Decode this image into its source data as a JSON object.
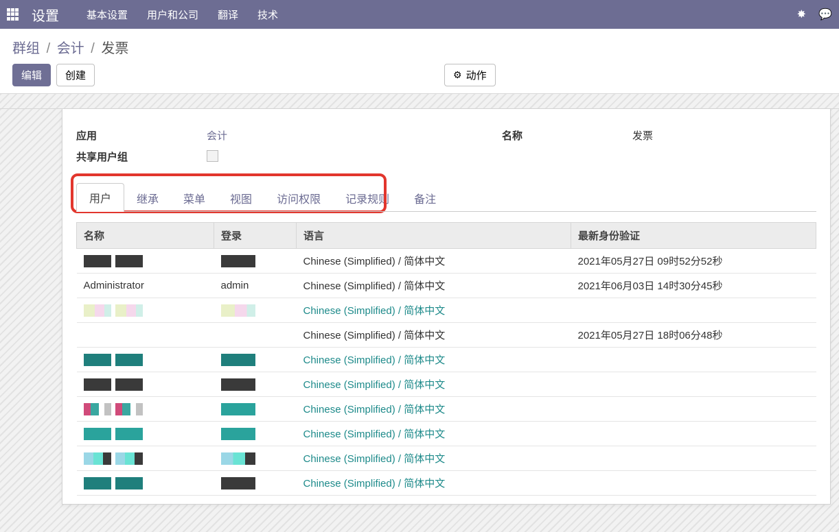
{
  "topnav": {
    "brand": "设置",
    "menu": [
      "基本设置",
      "用户和公司",
      "翻译",
      "技术"
    ]
  },
  "breadcrumb": {
    "root": "群组",
    "mid": "会计",
    "current": "发票"
  },
  "buttons": {
    "edit": "编辑",
    "create": "创建",
    "action": "动作"
  },
  "form": {
    "app_label": "应用",
    "app_value": "会计",
    "name_label": "名称",
    "name_value": "发票",
    "share_label": "共享用户组"
  },
  "tabs": [
    "用户",
    "继承",
    "菜单",
    "视图",
    "访问权限",
    "记录规则",
    "备注"
  ],
  "table": {
    "headers": {
      "name": "名称",
      "login": "登录",
      "lang": "语言",
      "last_auth": "最新身份验证"
    },
    "rows": [
      {
        "name_style": "redact dark",
        "login_style": "redact dark",
        "lang": "Chinese (Simplified) / 简体中文",
        "lang_link": false,
        "last": "2021年05月27日 09时52分52秒"
      },
      {
        "name": "Administrator",
        "login": "admin",
        "lang": "Chinese (Simplified) / 简体中文",
        "lang_link": false,
        "last": "2021年06月03日 14时30分45秒"
      },
      {
        "name_style": "redact light",
        "login_style": "redact light",
        "lang": "Chinese (Simplified) / 简体中文",
        "lang_link": true,
        "last": ""
      },
      {
        "name": "",
        "login": "",
        "lang": "Chinese (Simplified) / 简体中文",
        "lang_link": false,
        "last": "2021年05月27日 18时06分48秒"
      },
      {
        "name_style": "redact teal",
        "login_style": "redact teal",
        "lang": "Chinese (Simplified) / 简体中文",
        "lang_link": true,
        "last": ""
      },
      {
        "name_style": "redact dark",
        "login_style": "redact dark",
        "lang": "Chinese (Simplified) / 简体中文",
        "lang_link": true,
        "last": ""
      },
      {
        "name_style": "redact multi",
        "login_style": "redact teal2",
        "lang": "Chinese (Simplified) / 简体中文",
        "lang_link": true,
        "last": ""
      },
      {
        "name_style": "redact teal2",
        "login_style": "redact teal2",
        "lang": "Chinese (Simplified) / 简体中文",
        "lang_link": true,
        "last": ""
      },
      {
        "name_style": "redact multi2",
        "login_style": "redact multi2",
        "lang": "Chinese (Simplified) / 简体中文",
        "lang_link": true,
        "last": ""
      },
      {
        "name_style": "redact teal",
        "login_style": "redact dark",
        "lang": "Chinese (Simplified) / 简体中文",
        "lang_link": true,
        "last": ""
      }
    ]
  }
}
